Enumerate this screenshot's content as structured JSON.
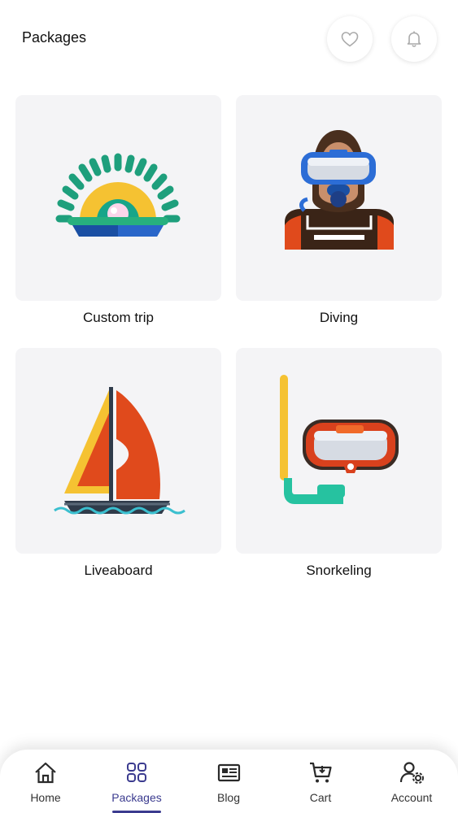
{
  "header": {
    "title": "Packages",
    "favorite_icon": "heart-icon",
    "notification_icon": "bell-icon"
  },
  "packages": [
    {
      "label": "Custom trip",
      "icon": "sunrise-shell-icon"
    },
    {
      "label": "Diving",
      "icon": "diver-icon"
    },
    {
      "label": "Liveaboard",
      "icon": "sailboat-icon"
    },
    {
      "label": "Snorkeling",
      "icon": "snorkel-mask-icon"
    }
  ],
  "nav": {
    "active": "Packages",
    "accent_color": "#3b3b8f",
    "items": [
      {
        "label": "Home",
        "icon": "home-icon"
      },
      {
        "label": "Packages",
        "icon": "grid-icon"
      },
      {
        "label": "Blog",
        "icon": "newspaper-icon"
      },
      {
        "label": "Cart",
        "icon": "cart-icon"
      },
      {
        "label": "Account",
        "icon": "user-settings-icon"
      }
    ]
  }
}
